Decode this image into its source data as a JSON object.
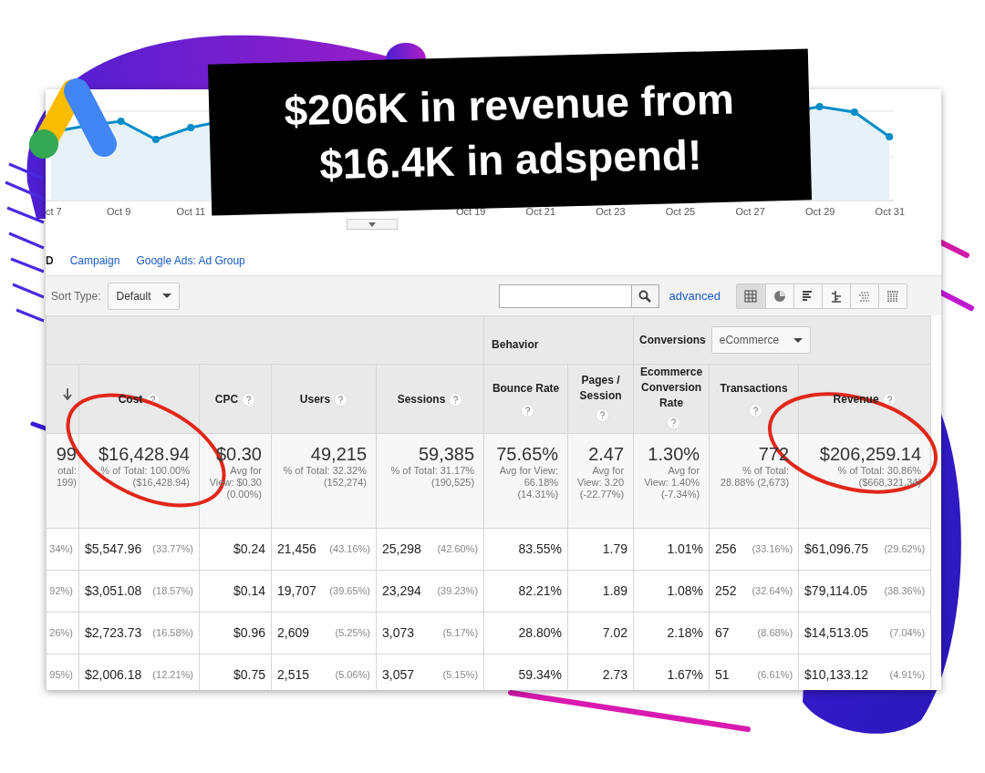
{
  "chart": {
    "x_labels": [
      "ct 7",
      "Oct 9",
      "Oct 11",
      "Oct 19",
      "Oct 21",
      "Oct 23",
      "Oct 25",
      "Oct 27",
      "Oct 29",
      "Oct 31"
    ]
  },
  "headline": [
    "$206K in revenue from",
    "$16.4K in adspend!"
  ],
  "tabs": [
    {
      "label": "D",
      "selected": true
    },
    {
      "label": "Campaign",
      "selected": false
    },
    {
      "label": "Google Ads: Ad Group",
      "selected": false
    }
  ],
  "toolbar": {
    "sort_label": "Sort Type:",
    "sort_value": "Default",
    "advanced_link": "advanced",
    "views": [
      {
        "kind": "table",
        "selected": true
      },
      {
        "kind": "pie",
        "selected": false
      },
      {
        "kind": "bars",
        "selected": false
      },
      {
        "kind": "comparison",
        "selected": false
      },
      {
        "kind": "cloud",
        "selected": false
      },
      {
        "kind": "pivot",
        "selected": false
      }
    ]
  },
  "table": {
    "behavior_label": "Behavior",
    "conversions_label": "Conversions",
    "conversions_select": "eCommerce",
    "columns": [
      {
        "kind": "sort"
      },
      {
        "kind": "metric",
        "label": "Cost",
        "help": true
      },
      {
        "kind": "metric",
        "label": "CPC",
        "help": true
      },
      {
        "kind": "metric",
        "label": "Users",
        "help": true
      },
      {
        "kind": "metric",
        "label": "Sessions",
        "help": true
      },
      {
        "kind": "metric",
        "label": "Bounce Rate",
        "help": true
      },
      {
        "kind": "metric",
        "label": "Pages / Session",
        "help": true
      },
      {
        "kind": "metric",
        "label": "Ecommerce Conversion Rate",
        "help": true
      },
      {
        "kind": "metric",
        "label": "Transactions",
        "help": true
      },
      {
        "kind": "metric",
        "label": "Revenue",
        "help": true
      }
    ],
    "totals": [
      {
        "value": "99",
        "note": "otal: 199)"
      },
      {
        "value": "$16,428.94",
        "note": "% of Total: 100.00% ($16,428.94)"
      },
      {
        "value": "$0.30",
        "note": "Avg for View: $0.30 (0.00%)"
      },
      {
        "value": "49,215",
        "note": "% of Total: 32.32% (152,274)"
      },
      {
        "value": "59,385",
        "note": "% of Total: 31.17% (190,525)"
      },
      {
        "value": "75.65%",
        "note": "Avg for View: 66.18% (14.31%)"
      },
      {
        "value": "2.47",
        "note": "Avg for View: 3.20 (-22.77%)"
      },
      {
        "value": "1.30%",
        "note": "Avg for View: 1.40% (-7.34%)"
      },
      {
        "value": "772",
        "note": "% of Total: 28.88% (2,673)"
      },
      {
        "value": "$206,259.14",
        "note": "% of Total: 30.86% ($668,321.34)"
      }
    ],
    "rows": [
      [
        {
          "share": "34%)"
        },
        {
          "value": "$5,547.96",
          "share": "(33.77%)"
        },
        {
          "value": "$0.24"
        },
        {
          "value": "21,456",
          "share": "(43.16%)"
        },
        {
          "value": "25,298",
          "share": "(42.60%)"
        },
        {
          "value": "83.55%"
        },
        {
          "value": "1.79"
        },
        {
          "value": "1.01%"
        },
        {
          "value": "256",
          "share": "(33.16%)"
        },
        {
          "value": "$61,096.75",
          "share": "(29.62%)"
        }
      ],
      [
        {
          "share": "92%)"
        },
        {
          "value": "$3,051.08",
          "share": "(18.57%)"
        },
        {
          "value": "$0.14"
        },
        {
          "value": "19,707",
          "share": "(39.65%)"
        },
        {
          "value": "23,294",
          "share": "(39.23%)"
        },
        {
          "value": "82.21%"
        },
        {
          "value": "1.89"
        },
        {
          "value": "1.08%"
        },
        {
          "value": "252",
          "share": "(32.64%)"
        },
        {
          "value": "$79,114.05",
          "share": "(38.36%)"
        }
      ],
      [
        {
          "share": "26%)"
        },
        {
          "value": "$2,723.73",
          "share": "(16.58%)"
        },
        {
          "value": "$0.96"
        },
        {
          "value": "2,609",
          "share": "(5.25%)"
        },
        {
          "value": "3,073",
          "share": "(5.17%)"
        },
        {
          "value": "28.80%"
        },
        {
          "value": "7.02"
        },
        {
          "value": "2.18%"
        },
        {
          "value": "67",
          "share": "(8.68%)"
        },
        {
          "value": "$14,513.05",
          "share": "(7.04%)"
        }
      ],
      [
        {
          "share": "95%)"
        },
        {
          "value": "$2,006.18",
          "share": "(12.21%)"
        },
        {
          "value": "$0.75"
        },
        {
          "value": "2,515",
          "share": "(5.06%)"
        },
        {
          "value": "3,057",
          "share": "(5.15%)"
        },
        {
          "value": "59.34%"
        },
        {
          "value": "2.73"
        },
        {
          "value": "1.67%"
        },
        {
          "value": "51",
          "share": "(6.61%)"
        },
        {
          "value": "$10,133.12",
          "share": "(4.91%)"
        }
      ]
    ]
  }
}
